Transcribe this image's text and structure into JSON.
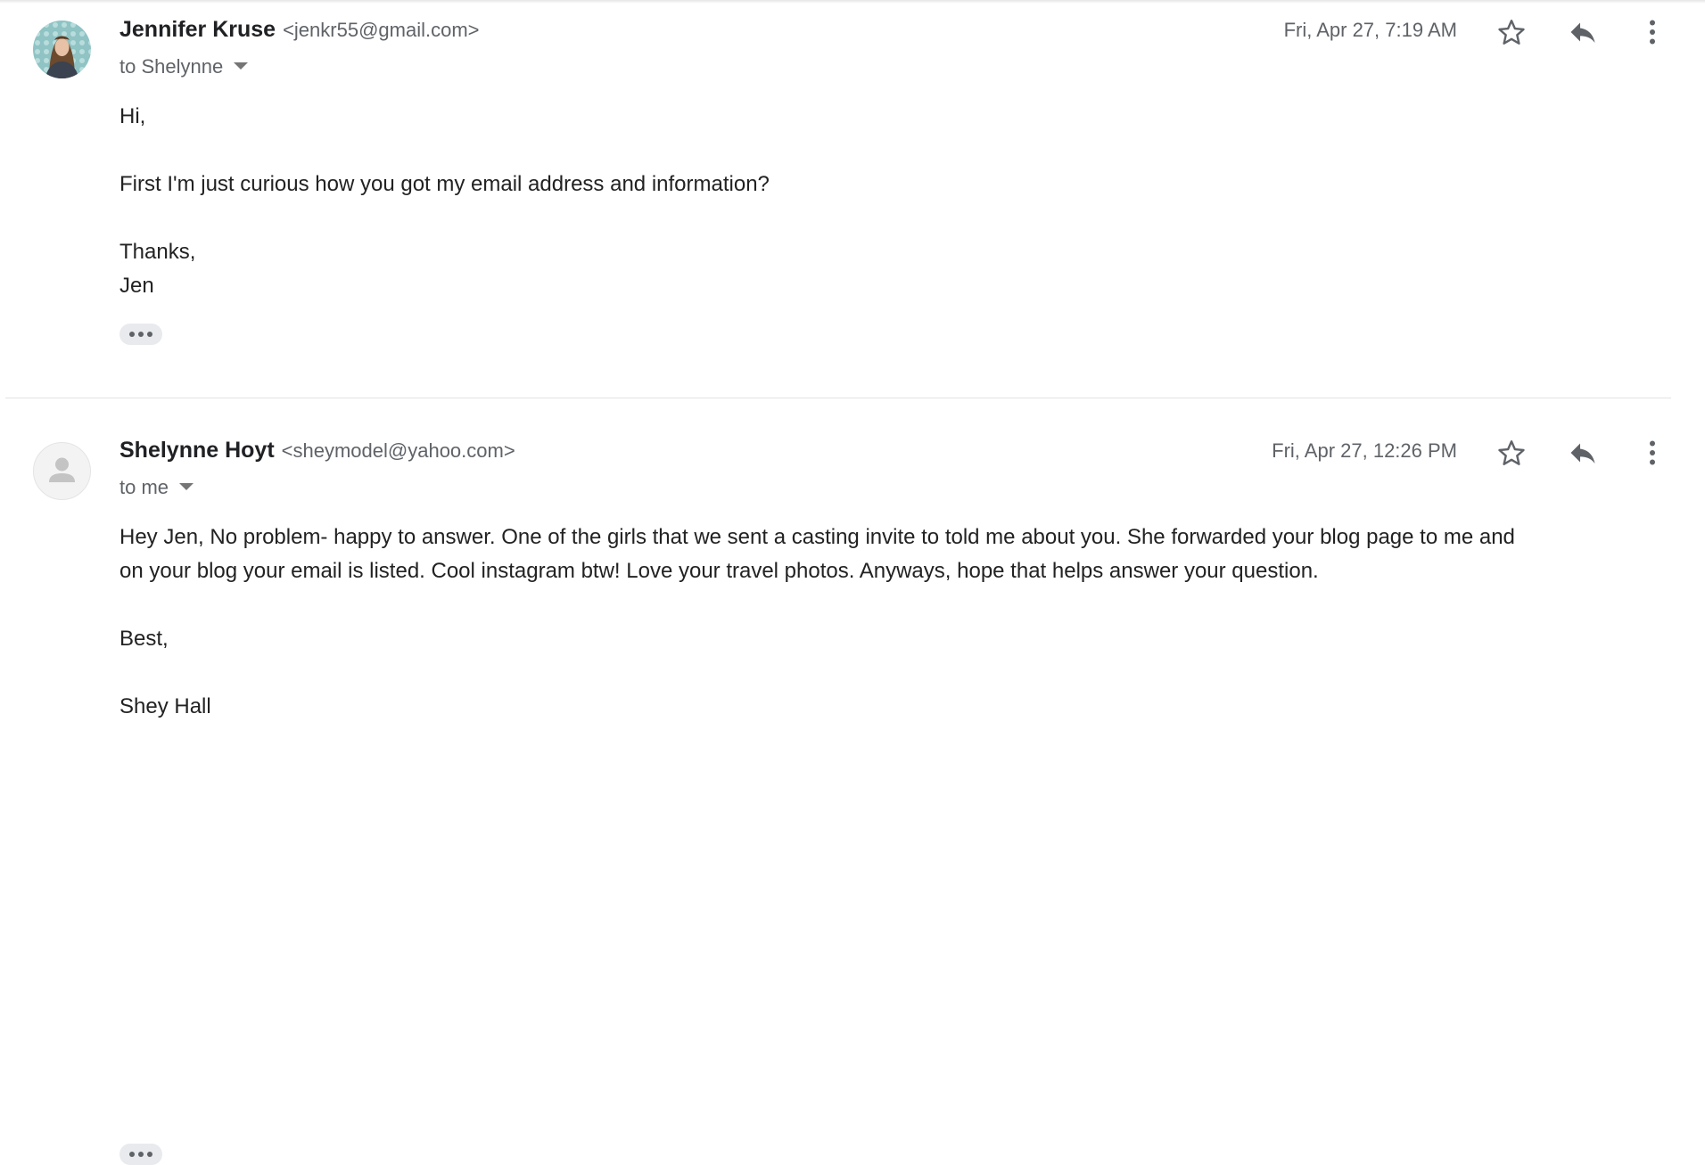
{
  "messages": [
    {
      "sender_name": "Jennifer Kruse",
      "sender_email": "<jenkr55@gmail.com>",
      "recipient": "to Shelynne",
      "date": "Fri, Apr 27, 7:19 AM",
      "avatar": "profile-photo",
      "body": {
        "greeting": "Hi,",
        "paragraph": "First I'm just curious how you got my email address and information?",
        "closing": "Thanks,",
        "signature": "Jen"
      }
    },
    {
      "sender_name": "Shelynne Hoyt",
      "sender_email": "<sheymodel@yahoo.com>",
      "recipient": "to me",
      "date": "Fri, Apr 27, 12:26 PM",
      "avatar": "default-person-icon",
      "body": {
        "paragraph_line1": "Hey Jen, No problem- happy to answer. One of the girls that we sent a casting invite to told me about you.  She forwarded your blog page to me and",
        "paragraph_line2": "on your blog your email is listed.  Cool instagram btw!  Love your travel photos.  Anyways, hope that helps answer your question.",
        "closing": "Best,",
        "signature": "Shey Hall"
      }
    }
  ],
  "icons": {
    "star": "star-outline-icon",
    "reply": "reply-icon",
    "more": "more-vert-icon",
    "trimmed": "show-trimmed-content-icon"
  },
  "colors": {
    "text": "#222222",
    "secondary": "#5f6368",
    "icon": "#5f6368",
    "divider": "#e3e3e3",
    "chip": "#e8eaed"
  }
}
